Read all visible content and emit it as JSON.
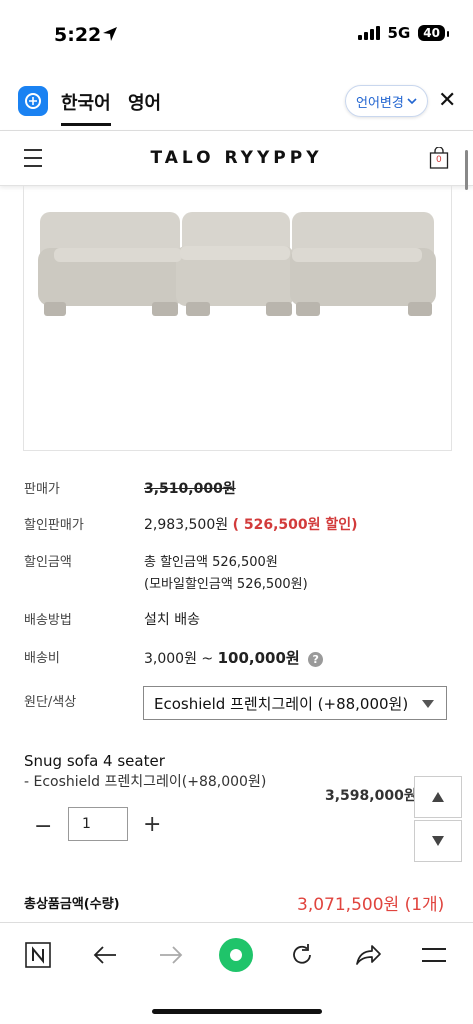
{
  "status_bar": {
    "time": "5:22",
    "network": "5G",
    "battery": "40"
  },
  "translate_bar": {
    "tab_korean": "한국어",
    "tab_english": "영어",
    "change_language": "언어변경"
  },
  "site": {
    "brand": "TALO RYYPPY",
    "cart_count": "0"
  },
  "product_info": {
    "price_label": "판매가",
    "price_value": "3,510,000원",
    "sale_label": "할인판매가",
    "sale_value": "2,983,500원",
    "sale_discount": "( 526,500원 할인)",
    "discount_label": "할인금액",
    "discount_total": "총 할인금액 526,500원",
    "discount_mobile": "(모바일할인금액 526,500원)",
    "shipping_method_label": "배송방법",
    "shipping_method_value": "설치 배송",
    "shipping_fee_label": "배송비",
    "shipping_fee_from": "3,000원 ~ ",
    "shipping_fee_to": "100,000원",
    "fabric_label": "원단/색상",
    "fabric_selected": "Ecoshield 프렌치그레이 (+88,000원)"
  },
  "selected_option": {
    "product_name": "Snug sofa 4 seater",
    "option_text": "- Ecoshield 프렌치그레이(+88,000원)",
    "price": "3,598,000원",
    "quantity": "1"
  },
  "total": {
    "label": "총상품금액(수량)",
    "value": "3,071,500원 (1개)"
  },
  "colors": {
    "accent_red": "#d23b3b",
    "translate_blue": "#2366d1",
    "nav_green": "#1fc46a"
  }
}
